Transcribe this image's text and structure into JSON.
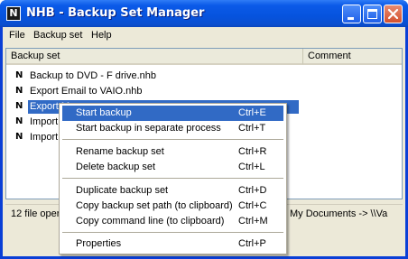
{
  "window": {
    "title": "NHB - Backup Set Manager",
    "app_icon_letter": "N",
    "controls": [
      "minimize",
      "maximize",
      "close"
    ]
  },
  "menubar": {
    "items": [
      {
        "label": "File"
      },
      {
        "label": "Backup set"
      },
      {
        "label": "Help"
      }
    ]
  },
  "list": {
    "columns": [
      "Backup set",
      "Comment"
    ],
    "row_icon_letter": "N",
    "rows": [
      {
        "label": "Backup to DVD - F drive.nhb",
        "selected": false
      },
      {
        "label": "Export Email to VAIO.nhb",
        "selected": false
      },
      {
        "label": "Export M",
        "selected": true
      },
      {
        "label": "Import E",
        "selected": false
      },
      {
        "label": "Import M",
        "selected": false
      }
    ]
  },
  "status": {
    "left": "12 file opera",
    "right": "My Documents -> \\\\Va"
  },
  "context_menu": {
    "groups": [
      [
        {
          "label": "Start backup",
          "shortcut": "Ctrl+E",
          "highlighted": true
        },
        {
          "label": "Start backup in separate process",
          "shortcut": "Ctrl+T",
          "highlighted": false
        }
      ],
      [
        {
          "label": "Rename backup set",
          "shortcut": "Ctrl+R",
          "highlighted": false
        },
        {
          "label": "Delete backup set",
          "shortcut": "Ctrl+L",
          "highlighted": false
        }
      ],
      [
        {
          "label": "Duplicate backup set",
          "shortcut": "Ctrl+D",
          "highlighted": false
        },
        {
          "label": "Copy backup set path (to clipboard)",
          "shortcut": "Ctrl+C",
          "highlighted": false
        },
        {
          "label": "Copy command line (to clipboard)",
          "shortcut": "Ctrl+M",
          "highlighted": false
        }
      ],
      [
        {
          "label": "Properties",
          "shortcut": "Ctrl+P",
          "highlighted": false
        }
      ]
    ]
  },
  "colors": {
    "title_bar": "#0653de",
    "selection": "#316ac5",
    "face": "#ece9d8"
  }
}
